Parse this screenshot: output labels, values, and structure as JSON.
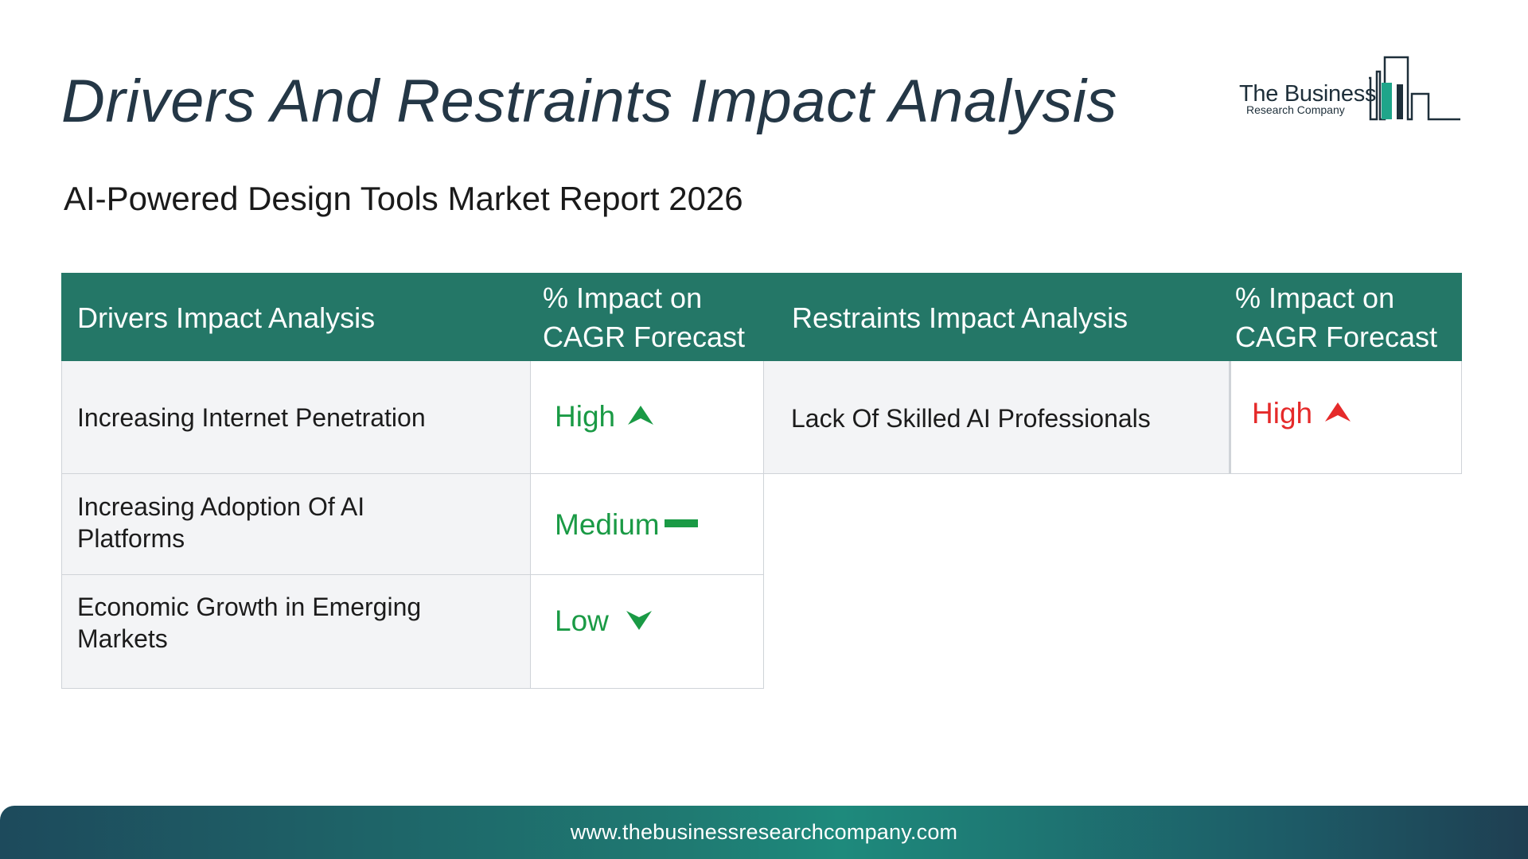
{
  "page": {
    "title": "Drivers And Restraints Impact Analysis",
    "subtitle": "AI-Powered Design Tools Market Report 2026"
  },
  "logo": {
    "line1": "The Business",
    "line2": "Research Company",
    "colors": {
      "text": "#1e2f3a",
      "accent": "#1fa58a"
    }
  },
  "table": {
    "headers": {
      "drivers": "Drivers Impact Analysis",
      "drivers_impact": "% Impact on CAGR Forecast",
      "restraints": "Restraints Impact Analysis",
      "restraints_impact": "% Impact on CAGR Forecast"
    },
    "header_color": "#247767",
    "drivers": [
      {
        "name": "Increasing Internet Penetration",
        "impact": "High",
        "icon": "arrow-up-icon",
        "color": "#1a9a45"
      },
      {
        "name": "Increasing Adoption Of AI Platforms",
        "impact": "Medium",
        "icon": "dash-icon",
        "color": "#1a9a45"
      },
      {
        "name": "Economic Growth in Emerging Markets",
        "impact": "Low",
        "icon": "arrow-down-icon",
        "color": "#1a9a45"
      }
    ],
    "restraints": [
      {
        "name": "Lack Of Skilled AI Professionals",
        "impact": "High",
        "icon": "arrow-up-icon",
        "color": "#e52a2a"
      }
    ]
  },
  "footer": {
    "url": "www.thebusinessresearchcompany.com"
  }
}
